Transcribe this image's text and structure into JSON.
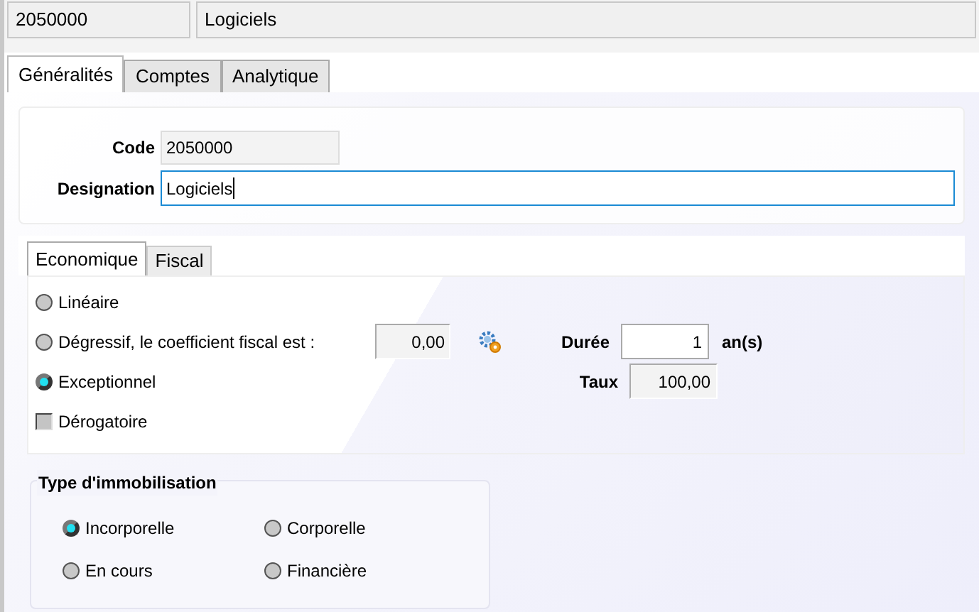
{
  "header": {
    "code": "2050000",
    "designation": "Logiciels"
  },
  "tabs": [
    {
      "label": "Généralités",
      "selected": true
    },
    {
      "label": "Comptes",
      "selected": false
    },
    {
      "label": "Analytique",
      "selected": false
    }
  ],
  "general": {
    "code_label": "Code",
    "code_value": "2050000",
    "designation_label": "Designation",
    "designation_value": "Logiciels"
  },
  "subtabs": [
    {
      "label": "Economique",
      "selected": true
    },
    {
      "label": "Fiscal",
      "selected": false
    }
  ],
  "economique": {
    "options": [
      {
        "kind": "radio",
        "label": "Linéaire",
        "selected": false
      },
      {
        "kind": "radio",
        "label": "Dégressif, le coefficient fiscal est :",
        "selected": false
      },
      {
        "kind": "radio",
        "label": "Exceptionnel",
        "selected": true
      },
      {
        "kind": "checkbox",
        "label": "Dérogatoire",
        "checked": false
      }
    ],
    "coefficient": "0,00",
    "duree_label": "Durée",
    "duree_value": "1",
    "duree_unit": "an(s)",
    "taux_label": "Taux",
    "taux_value": "100,00"
  },
  "type_group": {
    "title": "Type d'immobilisation",
    "options": [
      {
        "label": "Incorporelle",
        "selected": true
      },
      {
        "label": "Corporelle",
        "selected": false
      },
      {
        "label": "En cours",
        "selected": false
      },
      {
        "label": "Financière",
        "selected": false
      }
    ]
  }
}
